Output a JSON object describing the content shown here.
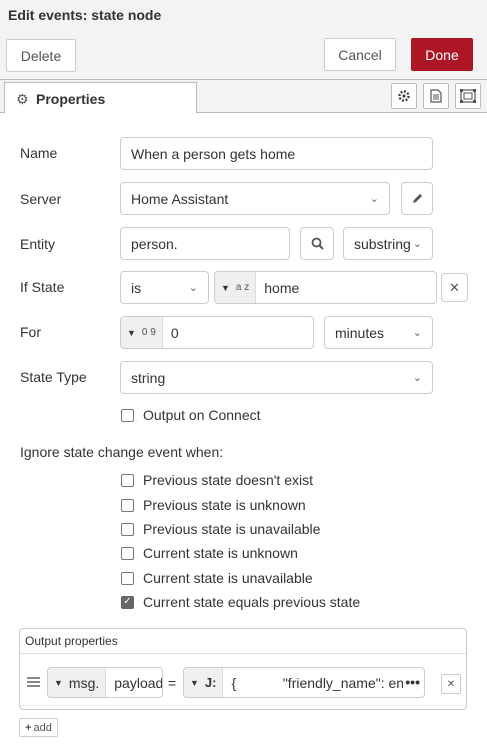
{
  "dialog": {
    "title": "Edit events: state node"
  },
  "toolbar": {
    "delete_label": "Delete",
    "cancel_label": "Cancel",
    "done_label": "Done"
  },
  "tabs": {
    "properties_label": "Properties"
  },
  "fields": {
    "name": {
      "label": "Name",
      "value": "When a person gets home"
    },
    "server": {
      "label": "Server",
      "value": "Home Assistant"
    },
    "entity": {
      "label": "Entity",
      "value": "person.",
      "match": "substring"
    },
    "if_state": {
      "label": "If State",
      "operator": "is",
      "type_glyph": "a z",
      "value": "home"
    },
    "for": {
      "label": "For",
      "type_glyph": "0 9",
      "value": "0",
      "unit": "minutes"
    },
    "state_type": {
      "label": "State Type",
      "value": "string"
    }
  },
  "output_on_connect": {
    "label": "Output on Connect",
    "checked": false
  },
  "ignore": {
    "heading": "Ignore state change event when:",
    "options": [
      {
        "label": "Previous state doesn't exist",
        "checked": false
      },
      {
        "label": "Previous state is unknown",
        "checked": false
      },
      {
        "label": "Previous state is unavailable",
        "checked": false
      },
      {
        "label": "Current state is unknown",
        "checked": false
      },
      {
        "label": "Current state is unavailable",
        "checked": false
      },
      {
        "label": "Current state equals previous state",
        "checked": true
      }
    ]
  },
  "output_properties": {
    "title": "Output properties",
    "row": {
      "prefix": "msg.",
      "property": "payload",
      "equals": "=",
      "value_type": "J:",
      "value": "{            \"friendly_name\": entity"
    },
    "add_label": "add"
  },
  "colors": {
    "primary": "#ad1625",
    "toolbar_bg": "#f3f3f3"
  }
}
